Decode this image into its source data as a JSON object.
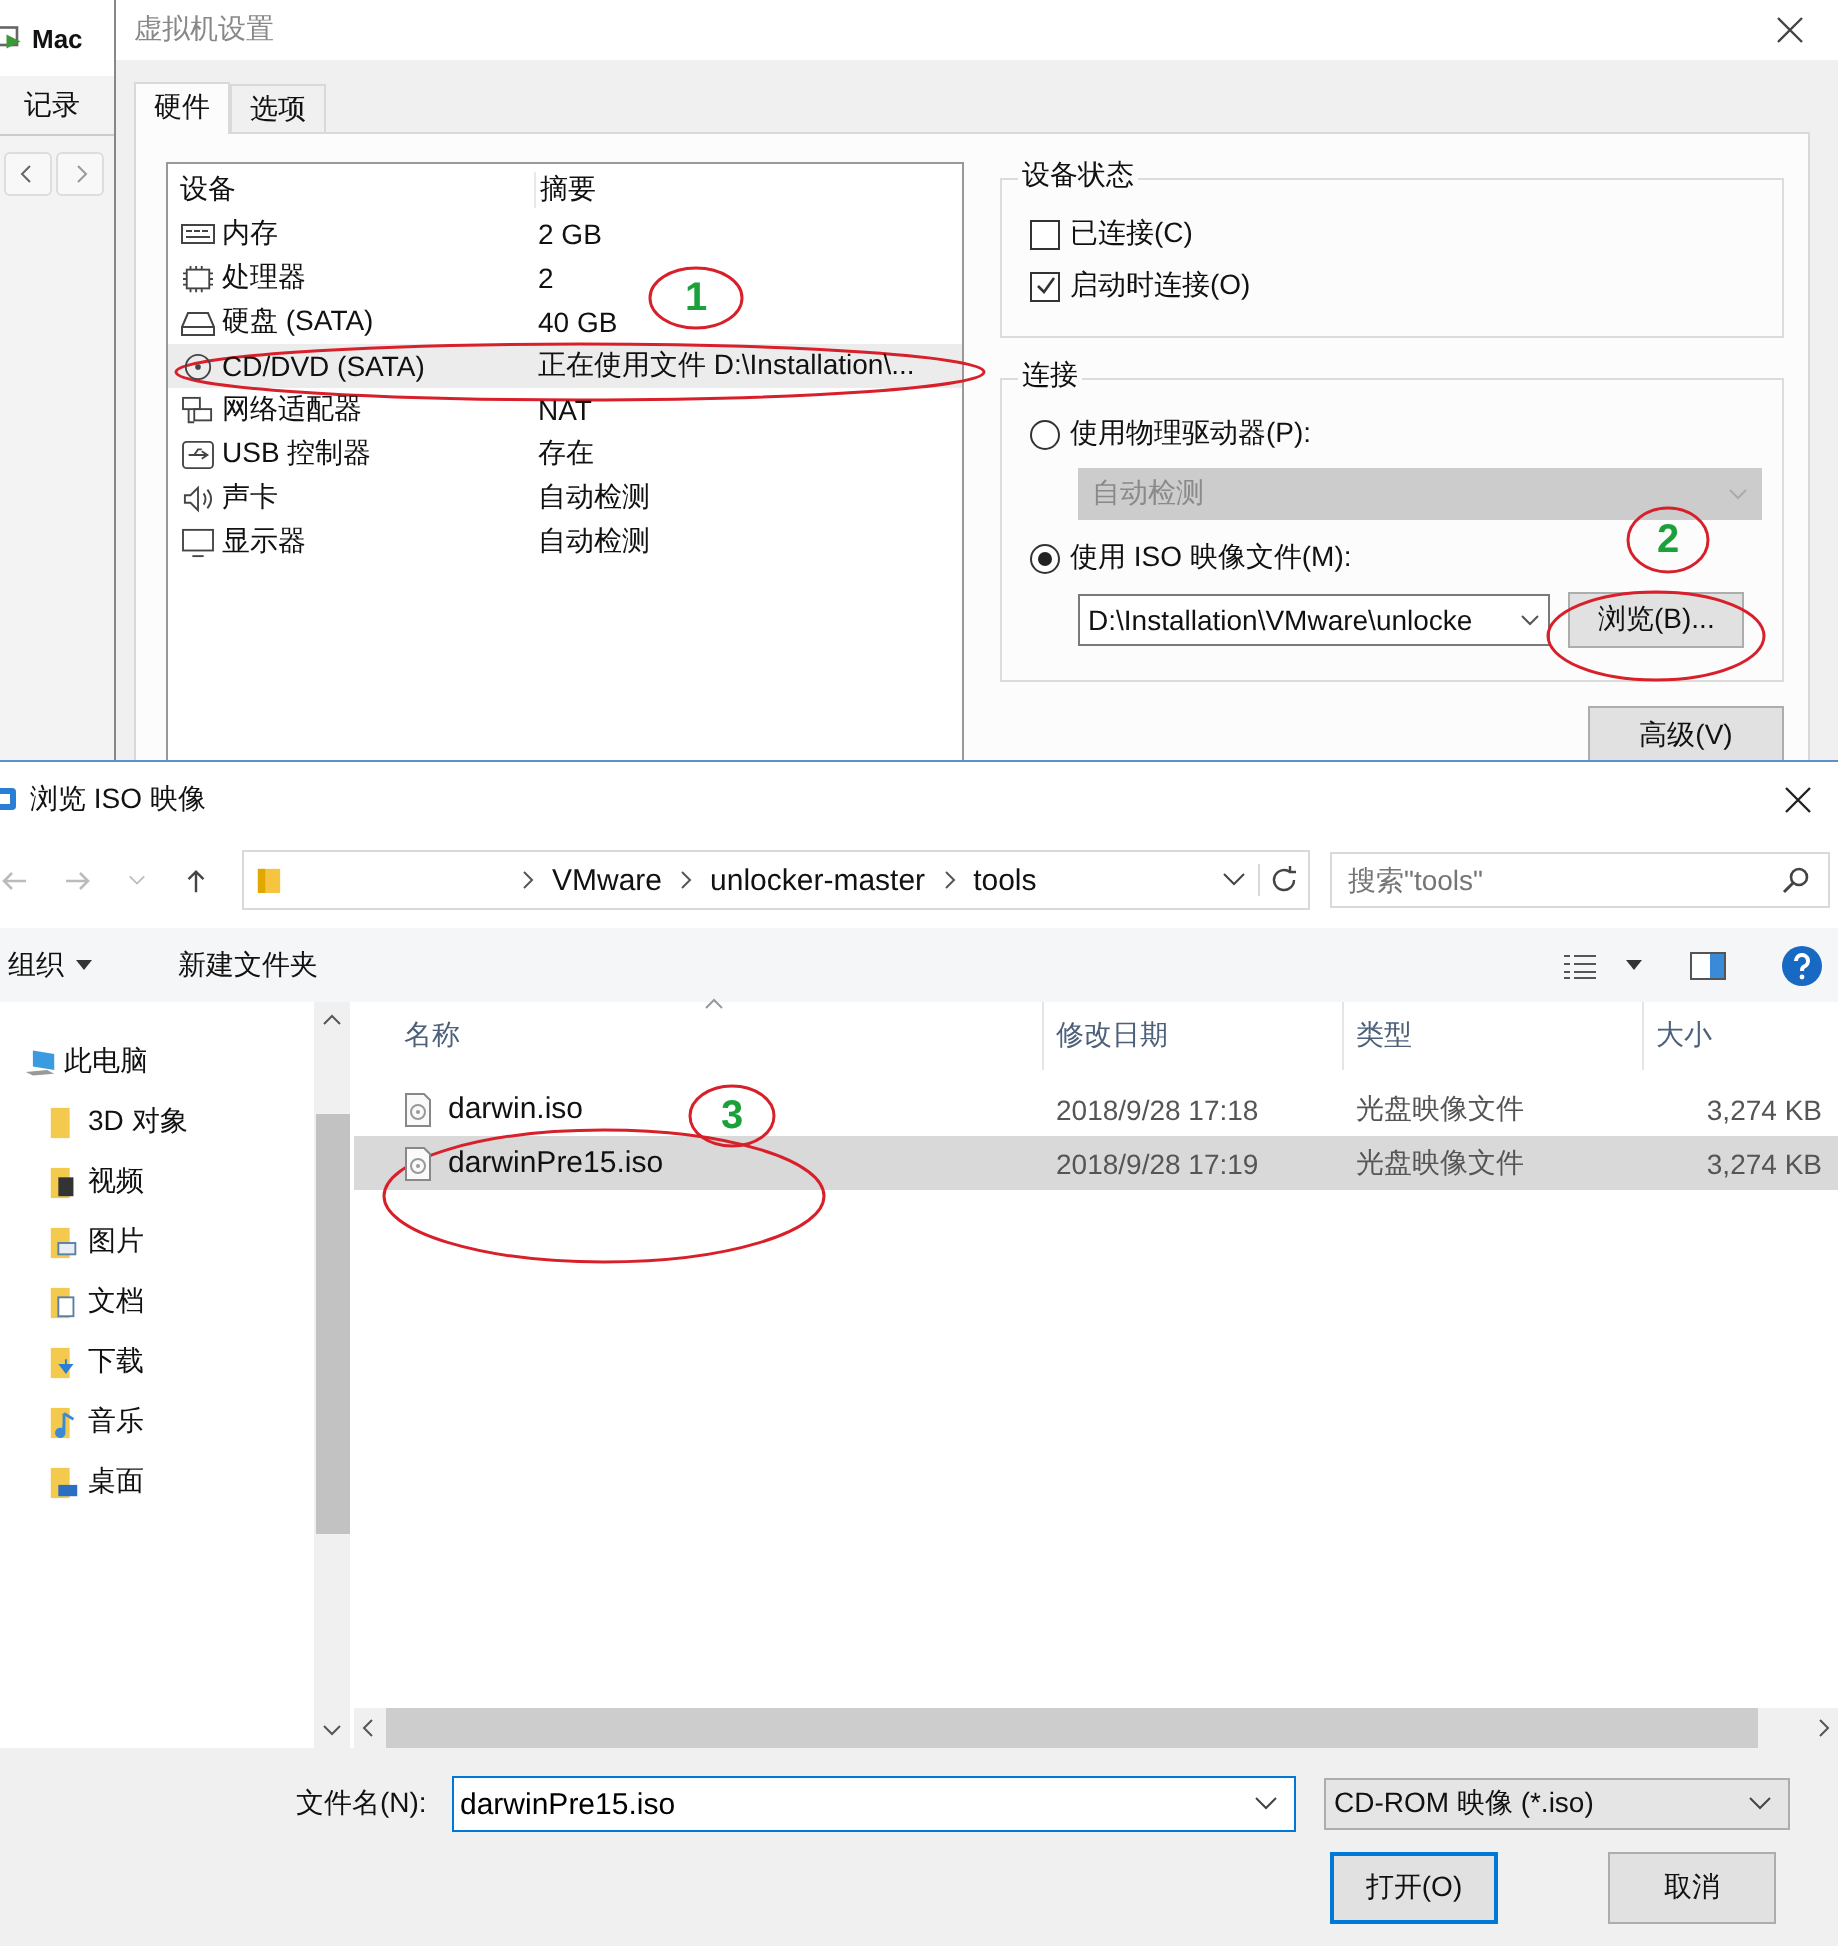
{
  "background_app": {
    "title": "Mac",
    "menu_item": "记录"
  },
  "settings_dialog": {
    "title": "虚拟机设置",
    "tabs": [
      {
        "label": "硬件",
        "selected": true
      },
      {
        "label": "选项",
        "selected": false
      }
    ],
    "device_list": {
      "columns": [
        "设备",
        "摘要"
      ],
      "rows": [
        {
          "kind": "memory",
          "device": "内存",
          "summary": "2 GB",
          "selected": false
        },
        {
          "kind": "cpu",
          "device": "处理器",
          "summary": "2",
          "selected": false
        },
        {
          "kind": "disk",
          "device": "硬盘 (SATA)",
          "summary": "40 GB",
          "selected": false
        },
        {
          "kind": "cdrom",
          "device": "CD/DVD (SATA)",
          "summary": "正在使用文件 D:\\Installation\\...",
          "selected": true
        },
        {
          "kind": "network",
          "device": "网络适配器",
          "summary": "NAT",
          "selected": false
        },
        {
          "kind": "usb",
          "device": "USB 控制器",
          "summary": "存在",
          "selected": false
        },
        {
          "kind": "sound",
          "device": "声卡",
          "summary": "自动检测",
          "selected": false
        },
        {
          "kind": "display",
          "device": "显示器",
          "summary": "自动检测",
          "selected": false
        }
      ]
    },
    "device_status": {
      "title": "设备状态",
      "options": [
        {
          "label": "已连接(C)",
          "checked": false
        },
        {
          "label": "启动时连接(O)",
          "checked": true
        }
      ]
    },
    "connection": {
      "title": "连接",
      "physical": {
        "label": "使用物理驱动器(P):",
        "selected": false,
        "drive": "自动检测",
        "disabled": true
      },
      "iso": {
        "label": "使用 ISO 映像文件(M):",
        "selected": true,
        "path": "D:\\Installation\\VMware\\unlocke"
      },
      "browse_button": "浏览(B)..."
    },
    "advanced_button": "高级(V)"
  },
  "file_dialog": {
    "title": "浏览 ISO 映像",
    "breadcrumb": [
      "VMware",
      "unlocker-master",
      "tools"
    ],
    "search": {
      "placeholder": "搜索\"tools\""
    },
    "toolbar": {
      "organize": "组织",
      "new_folder": "新建文件夹"
    },
    "sidebar": {
      "items": [
        {
          "kind": "pc",
          "label": "此电脑",
          "children": [
            {
              "kind": "objects",
              "label": "3D 对象"
            },
            {
              "kind": "video",
              "label": "视频"
            },
            {
              "kind": "pictures",
              "label": "图片"
            },
            {
              "kind": "documents",
              "label": "文档"
            },
            {
              "kind": "downloads",
              "label": "下载"
            },
            {
              "kind": "music",
              "label": "音乐"
            },
            {
              "kind": "desktop",
              "label": "桌面"
            }
          ]
        }
      ]
    },
    "table": {
      "columns": [
        "名称",
        "修改日期",
        "类型",
        "大小"
      ],
      "rows": [
        {
          "name": "darwin.iso",
          "modified": "2018/9/28 17:18",
          "type": "光盘映像文件",
          "size": "3,274 KB",
          "selected": false
        },
        {
          "name": "darwinPre15.iso",
          "modified": "2018/9/28 17:19",
          "type": "光盘映像文件",
          "size": "3,274 KB",
          "selected": true
        }
      ]
    },
    "file_name": {
      "label": "文件名(N):",
      "value": "darwinPre15.iso"
    },
    "file_type": "CD-ROM 映像 (*.iso)",
    "buttons": [
      "打开(O)",
      "取消"
    ]
  },
  "annotations": [
    {
      "label": "1"
    },
    {
      "label": "2"
    },
    {
      "label": "3"
    }
  ]
}
